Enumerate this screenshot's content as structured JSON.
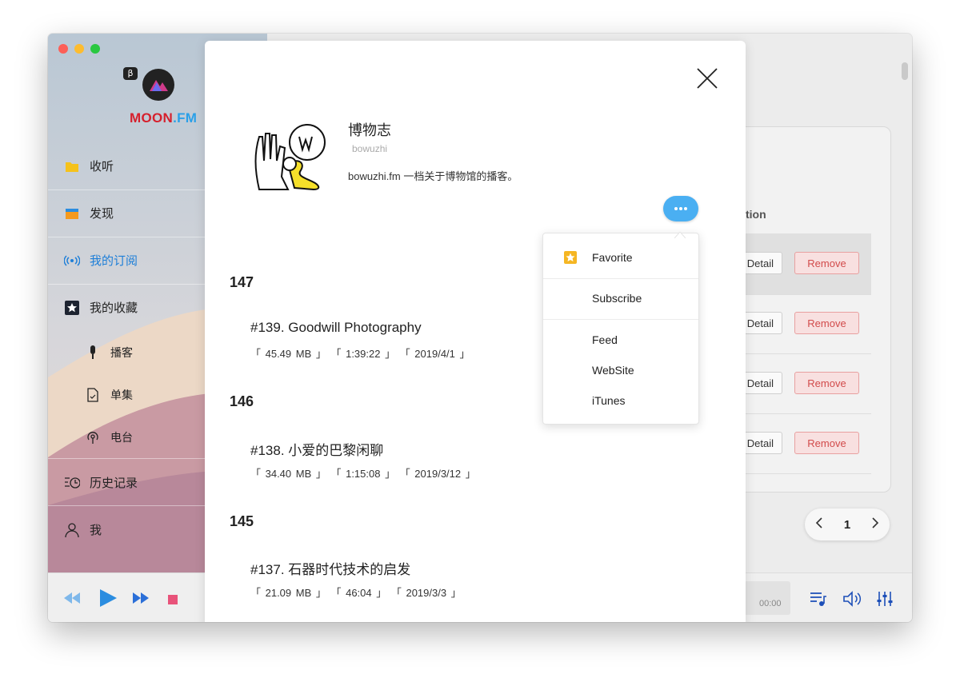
{
  "app": {
    "brand_part1": "MOON",
    "brand_part2": ".FM",
    "beta_label": "β"
  },
  "sidebar": {
    "items": [
      {
        "label": "收听",
        "icon": "folder-icon"
      },
      {
        "label": "发现",
        "icon": "box-icon"
      },
      {
        "label": "我的订阅",
        "icon": "broadcast-icon"
      },
      {
        "label": "我的收藏",
        "icon": "star-icon"
      },
      {
        "label": "播客",
        "icon": "microphone-icon"
      },
      {
        "label": "单集",
        "icon": "file-icon"
      },
      {
        "label": "电台",
        "icon": "radio-icon"
      },
      {
        "label": "历史记录",
        "icon": "history-icon"
      },
      {
        "label": "我",
        "icon": "user-icon"
      }
    ]
  },
  "background": {
    "column_header": "tion",
    "detail_label": "Detail",
    "remove_label": "Remove",
    "page": "1",
    "time": "00:00"
  },
  "podcast": {
    "title": "博物志",
    "subtitle": "bowuzhi",
    "description": "bowuzhi.fm 一档关于博物馆的播客。"
  },
  "more_menu": {
    "favorite": "Favorite",
    "subscribe": "Subscribe",
    "feed": "Feed",
    "website": "WebSite",
    "itunes": "iTunes"
  },
  "episodes": [
    {
      "number": "147",
      "title": "#139. Goodwill Photography",
      "meta": "「 45.49 MB 」 「 1:39:22 」 「 2019/4/1 」"
    },
    {
      "number": "146",
      "title": "#138. 小爱的巴黎闲聊",
      "meta": "「 34.40 MB 」 「 1:15:08 」 「 2019/3/12 」"
    },
    {
      "number": "145",
      "title": "#137. 石器时代技术的启发",
      "meta": "「 21.09 MB 」 「 46:04 」 「 2019/3/3 」"
    }
  ],
  "colors": {
    "accent": "#1e7fd8",
    "brand_red": "#d6202d",
    "brand_blue": "#2aa0e8",
    "remove_red": "#d24b4b",
    "more_button": "#4aaff2"
  }
}
